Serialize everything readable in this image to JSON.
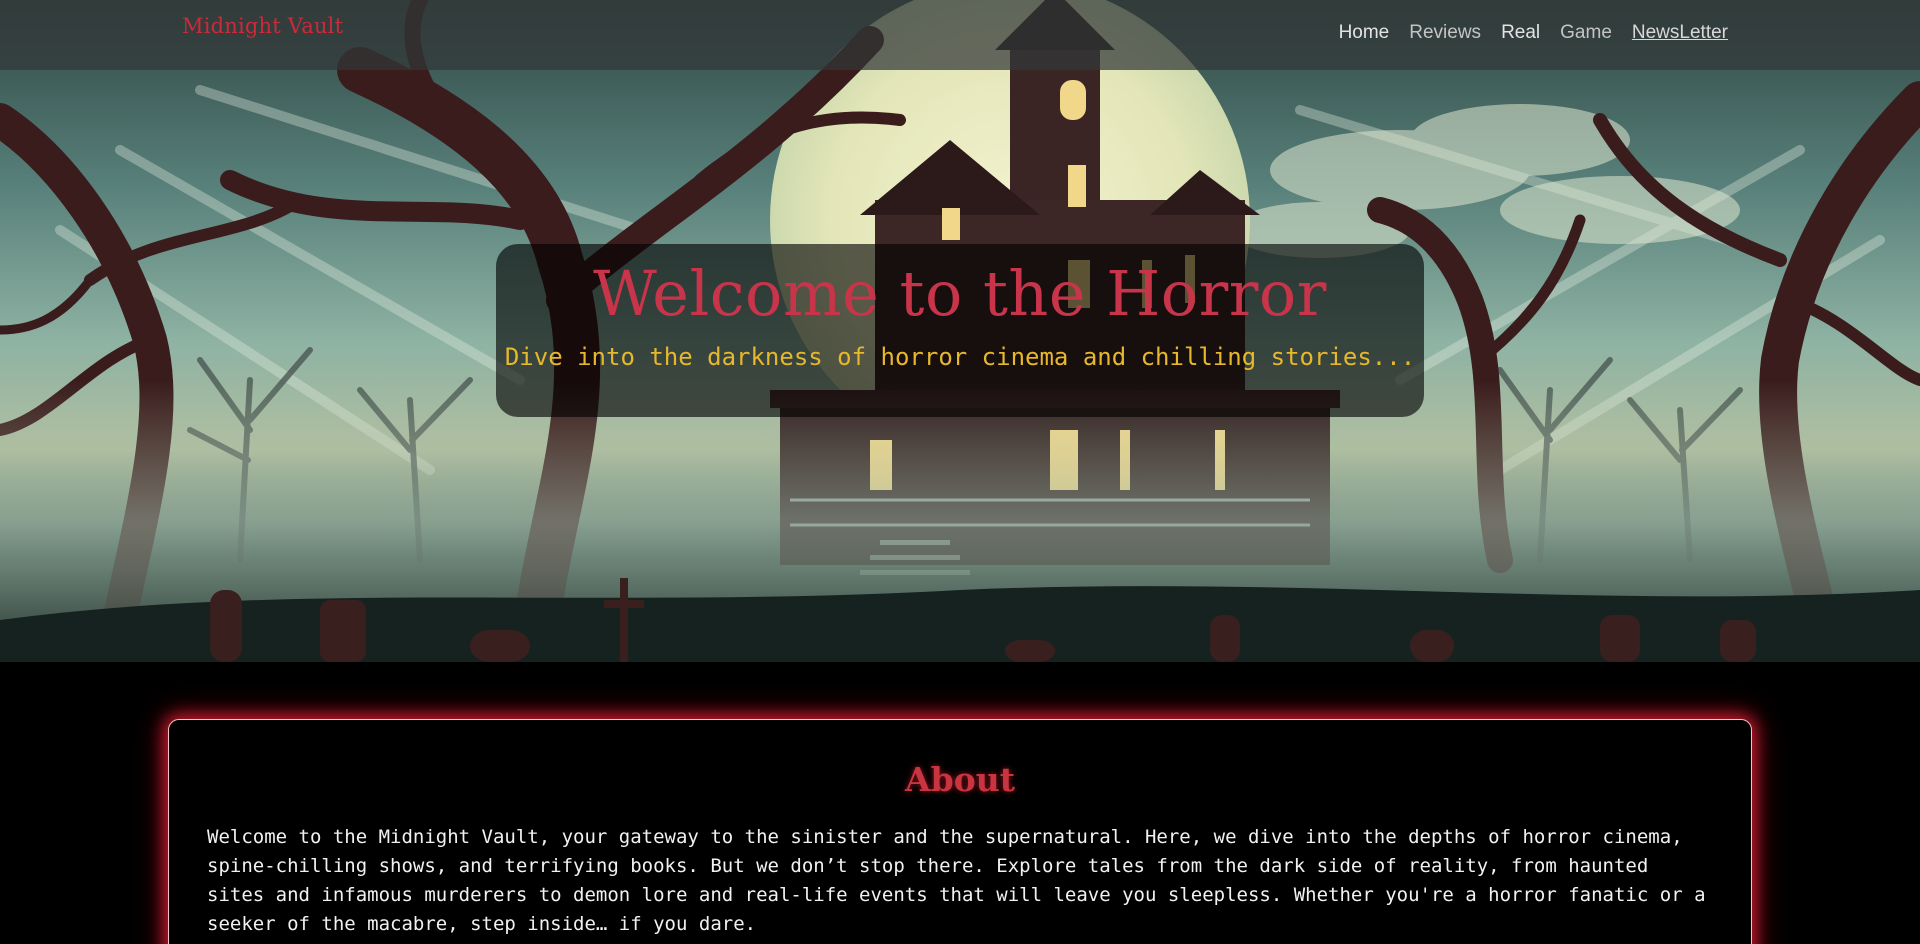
{
  "nav": {
    "brand": "Midnight Vault",
    "links": [
      "Home",
      "Reviews",
      "Real",
      "Game",
      "NewsLetter"
    ]
  },
  "hero": {
    "title": "Welcome to the Horror",
    "subtitle": "Dive into the darkness of horror cinema and chilling stories..."
  },
  "about": {
    "title": "About",
    "text": "Welcome to the Midnight Vault, your gateway to the sinister and the supernatural. Here, we dive into the depths of horror cinema, spine-chilling shows, and terrifying books. But we don’t stop there. Explore tales from the dark side of reality, from haunted sites and infamous murderers to demon lore and real-life events that will leave you sleepless. Whether you're a horror fanatic or a seeker of the macabre, step inside… if you dare."
  },
  "colors": {
    "accent_red": "#c8344a",
    "subtitle_gold": "#e7b72c",
    "page_background": "#000000"
  }
}
